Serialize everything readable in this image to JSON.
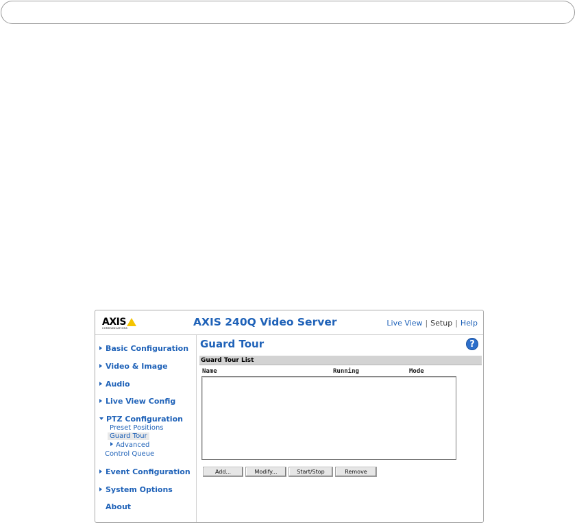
{
  "header": {
    "logo_text": "AXIS",
    "logo_sub": "COMMUNICATIONS",
    "product_title": "AXIS 240Q Video Server",
    "nav": {
      "live_view": "Live View",
      "setup": "Setup",
      "help": "Help",
      "separator": "|"
    }
  },
  "sidebar": {
    "items": [
      {
        "label": "Basic Configuration"
      },
      {
        "label": "Video & Image"
      },
      {
        "label": "Audio"
      },
      {
        "label": "Live View Config"
      },
      {
        "label": "PTZ Configuration"
      },
      {
        "label": "Event Configuration"
      },
      {
        "label": "System Options"
      },
      {
        "label": "About"
      }
    ],
    "ptz_sub": {
      "preset_positions": "Preset Positions",
      "guard_tour": "Guard Tour",
      "advanced": "Advanced",
      "control_queue": "Control Queue"
    }
  },
  "main": {
    "title": "Guard Tour",
    "help_glyph": "?",
    "section_title": "Guard Tour List",
    "columns": [
      "Name",
      "Running",
      "Mode"
    ],
    "buttons": {
      "add": "Add...",
      "modify": "Modify...",
      "start_stop": "Start/Stop",
      "remove": "Remove"
    }
  },
  "colors": {
    "accent": "#1f62b8",
    "logo_yellow": "#f5c400",
    "section_bar": "#d3d3d3"
  }
}
